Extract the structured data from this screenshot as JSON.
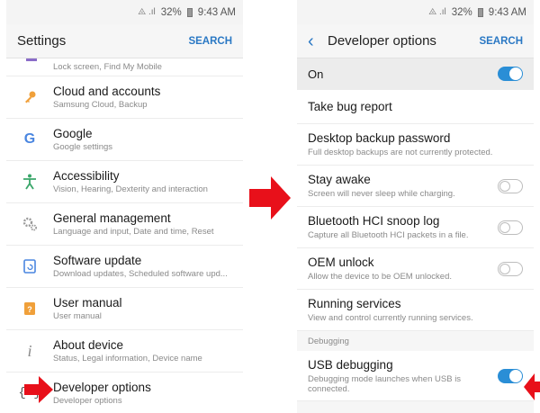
{
  "status": {
    "signal": "⨻ .ıl",
    "battery": "32%",
    "time": "9:43 AM"
  },
  "left": {
    "title": "Settings",
    "action": "SEARCH",
    "partial_text": "Lock screen, Find My Mobile",
    "items": [
      {
        "title": "Cloud and accounts",
        "subtitle": "Samsung Cloud, Backup",
        "icon": "key-icon"
      },
      {
        "title": "Google",
        "subtitle": "Google settings",
        "icon": "google-icon"
      },
      {
        "title": "Accessibility",
        "subtitle": "Vision, Hearing, Dexterity and interaction",
        "icon": "accessibility-icon"
      },
      {
        "title": "General management",
        "subtitle": "Language and input, Date and time, Reset",
        "icon": "gears-icon"
      },
      {
        "title": "Software update",
        "subtitle": "Download updates, Scheduled software upd...",
        "icon": "software-update-icon"
      },
      {
        "title": "User manual",
        "subtitle": "User manual",
        "icon": "manual-icon"
      },
      {
        "title": "About device",
        "subtitle": "Status, Legal information, Device name",
        "icon": "info-icon"
      },
      {
        "title": "Developer options",
        "subtitle": "Developer options",
        "icon": "developer-icon"
      }
    ]
  },
  "right": {
    "title": "Developer options",
    "action": "SEARCH",
    "on_label": "On",
    "bug_report": "Take bug report",
    "desktop_pw": {
      "title": "Desktop backup password",
      "subtitle": "Full desktop backups are not currently protected."
    },
    "stay_awake": {
      "title": "Stay awake",
      "subtitle": "Screen will never sleep while charging."
    },
    "bt_snoop": {
      "title": "Bluetooth HCI snoop log",
      "subtitle": "Capture all Bluetooth HCI packets in a file."
    },
    "oem_unlock": {
      "title": "OEM unlock",
      "subtitle": "Allow the device to be OEM unlocked."
    },
    "running": {
      "title": "Running services",
      "subtitle": "View and control currently running services."
    },
    "section_debugging": "Debugging",
    "usb_debugging": {
      "title": "USB debugging",
      "subtitle": "Debugging mode launches when USB is connected."
    }
  },
  "colors": {
    "accent": "#2a78c4",
    "toggle_on": "#2a8ed6",
    "arrow": "#e8101a"
  }
}
